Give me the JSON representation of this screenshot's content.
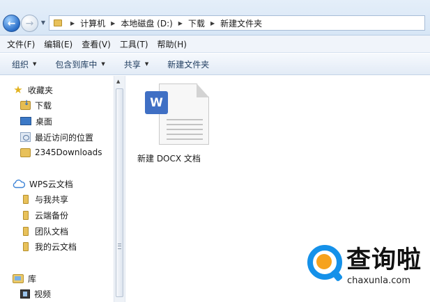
{
  "address_bar": {
    "breadcrumbs": [
      "计算机",
      "本地磁盘 (D:)",
      "下载",
      "新建文件夹"
    ]
  },
  "menubar": {
    "items": [
      "文件(F)",
      "编辑(E)",
      "查看(V)",
      "工具(T)",
      "帮助(H)"
    ]
  },
  "commandbar": {
    "organize": "组织",
    "include_in_library": "包含到库中",
    "share": "共享",
    "new_folder": "新建文件夹"
  },
  "navigation": {
    "favorites": {
      "label": "收藏夹",
      "items": [
        "下载",
        "桌面",
        "最近访问的位置",
        "2345Downloads"
      ]
    },
    "wps_cloud": {
      "label": "WPS云文档",
      "items": [
        "与我共享",
        "云端备份",
        "团队文档",
        "我的云文档"
      ]
    },
    "libraries": {
      "label": "库",
      "items": [
        "视频"
      ]
    }
  },
  "content": {
    "files": [
      {
        "name": "新建 DOCX 文档",
        "badge": "W",
        "icon": "wps-writer-document-icon"
      }
    ]
  },
  "watermark": {
    "title": "查询啦",
    "url": "chaxunla.com"
  },
  "colors": {
    "wps_blue": "#3f6fc4",
    "watermark_blue": "#1591e9",
    "watermark_orange": "#f6a21d"
  }
}
